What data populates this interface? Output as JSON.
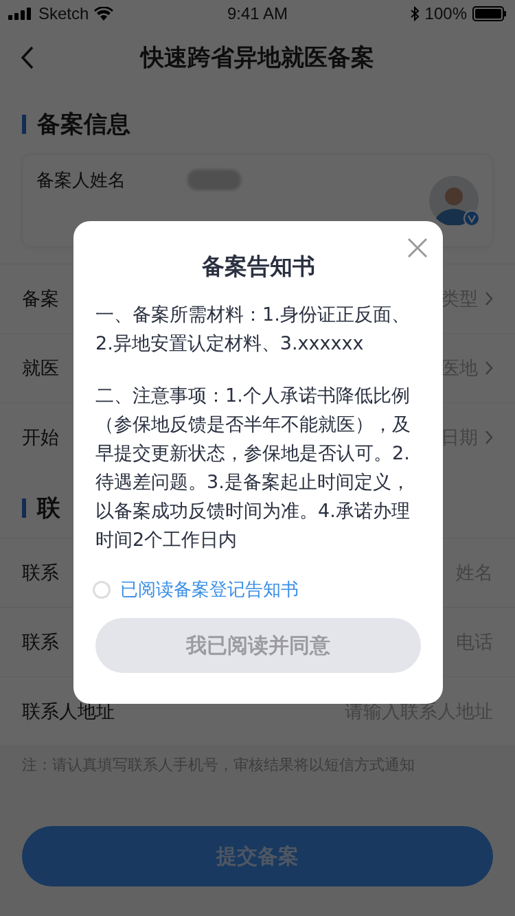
{
  "status_bar": {
    "carrier": "Sketch",
    "time": "9:41 AM",
    "battery": "100%"
  },
  "nav": {
    "title": "快速跨省异地就医备案"
  },
  "sections": [
    {
      "title": "备案信息",
      "card": [
        {
          "label": "备案人姓名",
          "kind": "blurred"
        },
        {
          "kind": "hidden"
        }
      ],
      "rows": [
        {
          "label": "备案",
          "value": "类型",
          "kind": "select"
        },
        {
          "label": "就医",
          "value": "医地",
          "kind": "select"
        },
        {
          "label": "开始",
          "value": "日期",
          "kind": "select"
        }
      ]
    },
    {
      "title": "联",
      "rows": [
        {
          "label": "联系",
          "value": "姓名",
          "kind": "input"
        },
        {
          "label": "联系",
          "value": "电话",
          "kind": "input"
        },
        {
          "label": "联系人地址",
          "value": "请输入联系人地址",
          "kind": "input"
        }
      ]
    }
  ],
  "note": "注：请认真填写联系人手机号，审核结果将以短信方式通知",
  "submit": "提交备案",
  "modal": {
    "title": "备案告知书",
    "paragraphs": [
      "一、备案所需材料：1.身份证正反面、2.异地安置认定材料、3.xxxxxx",
      "二、注意事项：1.个人承诺书降低比例（参保地反馈是否半年不能就医），及早提交更新状态，参保地是否认可。2.待遇差问题。3.是备案起止时间定义，以备案成功反馈时间为准。4.承诺办理时间2个工作日内"
    ],
    "agree": {
      "label": "已阅读备案登记告知书",
      "checked": false
    },
    "confirm": {
      "label": "我已阅读并同意",
      "disabled": true
    }
  }
}
